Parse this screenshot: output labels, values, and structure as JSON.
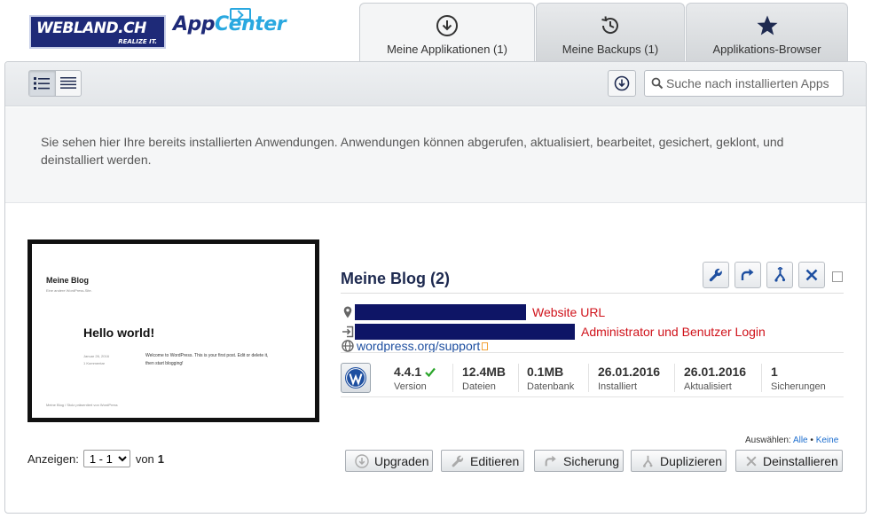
{
  "brand": {
    "logo_main": "WEBLAND.CH",
    "logo_tagline": "REALIZE IT.",
    "app_part1": "App",
    "app_part2": "Center"
  },
  "tabs": [
    {
      "label": "Meine Applikationen (1)",
      "icon": "download-circle-icon",
      "active": true
    },
    {
      "label": "Meine Backups (1)",
      "icon": "history-icon",
      "active": false
    },
    {
      "label": "Applikations-Browser",
      "icon": "star-icon",
      "active": false
    }
  ],
  "toolbar": {
    "search_placeholder": "Suche nach installierten Apps"
  },
  "info_text": "Sie sehen hier Ihre bereits installierten Anwendungen. Anwendungen können abgerufen, aktualisiert, bearbeitet, gesichert, geklont, und deinstalliert werden.",
  "thumbnail": {
    "site_title": "Meine Blog",
    "site_subtitle": "Eine andere WordPress-Site.",
    "post_title": "Hello world!",
    "post_date": "Januar 26, 2016",
    "post_comments": "1 Kommentar",
    "post_body": "Welcome to WordPress. This is your first post. Edit or delete it, then start blogging!",
    "footer": "Meine Blog  /  Stolz präsentiert von WordPress"
  },
  "app": {
    "title": "Meine Blog (2)",
    "website_label": "Website URL",
    "admin_label": "Administrator und Benutzer Login",
    "support_link": "wordpress.org/support",
    "stats": [
      {
        "value": "4.4.1",
        "label": "Version"
      },
      {
        "value": "12.4MB",
        "label": "Dateien"
      },
      {
        "value": "0.1MB",
        "label": "Datenbank"
      },
      {
        "value": "26.01.2016",
        "label": "Installiert"
      },
      {
        "value": "26.01.2016",
        "label": "Aktualisiert"
      },
      {
        "value": "1",
        "label": "Sicherungen"
      }
    ]
  },
  "selection": {
    "label": "Auswählen:",
    "all": "Alle",
    "separator": "•",
    "none": "Keine"
  },
  "pager": {
    "label": "Anzeigen:",
    "selected": "1 - 1",
    "of_label": "von",
    "total": "1"
  },
  "buttons": {
    "upgrade": "Upgraden",
    "edit": "Editieren",
    "backup": "Sicherung",
    "duplicate": "Duplizieren",
    "uninstall": "Deinstallieren"
  },
  "colors": {
    "navy": "#1e2a78",
    "accent_blue": "#29a8e0",
    "link": "#1e4fa0",
    "alert_red": "#d0131b",
    "check_green": "#2aa52a"
  }
}
